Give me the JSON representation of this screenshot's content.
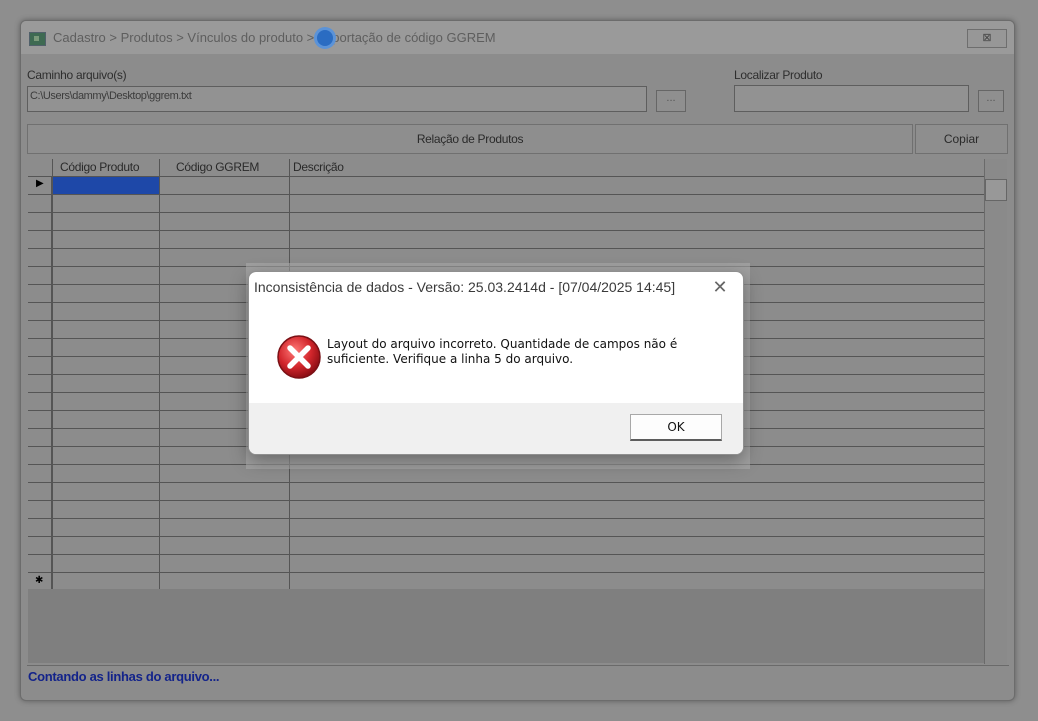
{
  "window": {
    "title": "Cadastro > Produtos > Vínculos do produto > Importação de código GGREM",
    "close_label": "⊠"
  },
  "file_path": {
    "label": "Caminho arquivo(s)",
    "value": "C:\\Users\\dammy\\Desktop\\ggrem.txt",
    "browse_label": "..."
  },
  "product_search": {
    "label": "Localizar Produto",
    "value": "",
    "search_label": "..."
  },
  "section": {
    "title": "Relação de Produtos",
    "copy_label": "Copiar"
  },
  "grid": {
    "columns": [
      "Código Produto",
      "Código GGREM",
      "Descrição"
    ],
    "current_row_marker": "▶",
    "new_row_marker": "✱"
  },
  "status_text": "Contando as linhas do arquivo...",
  "dialog": {
    "title": "Inconsistência de dados - Versão: 25.03.2414d - [07/04/2025 14:45]",
    "close_label": "✕",
    "message": "Layout do arquivo incorreto. Quantidade de campos não é suficiente. Verifique a linha 5 do arquivo.",
    "ok_label": "OK"
  },
  "colors": {
    "error_red": "#c8242c",
    "status_blue": "#13238a",
    "selection_blue": "#1e48a8"
  }
}
